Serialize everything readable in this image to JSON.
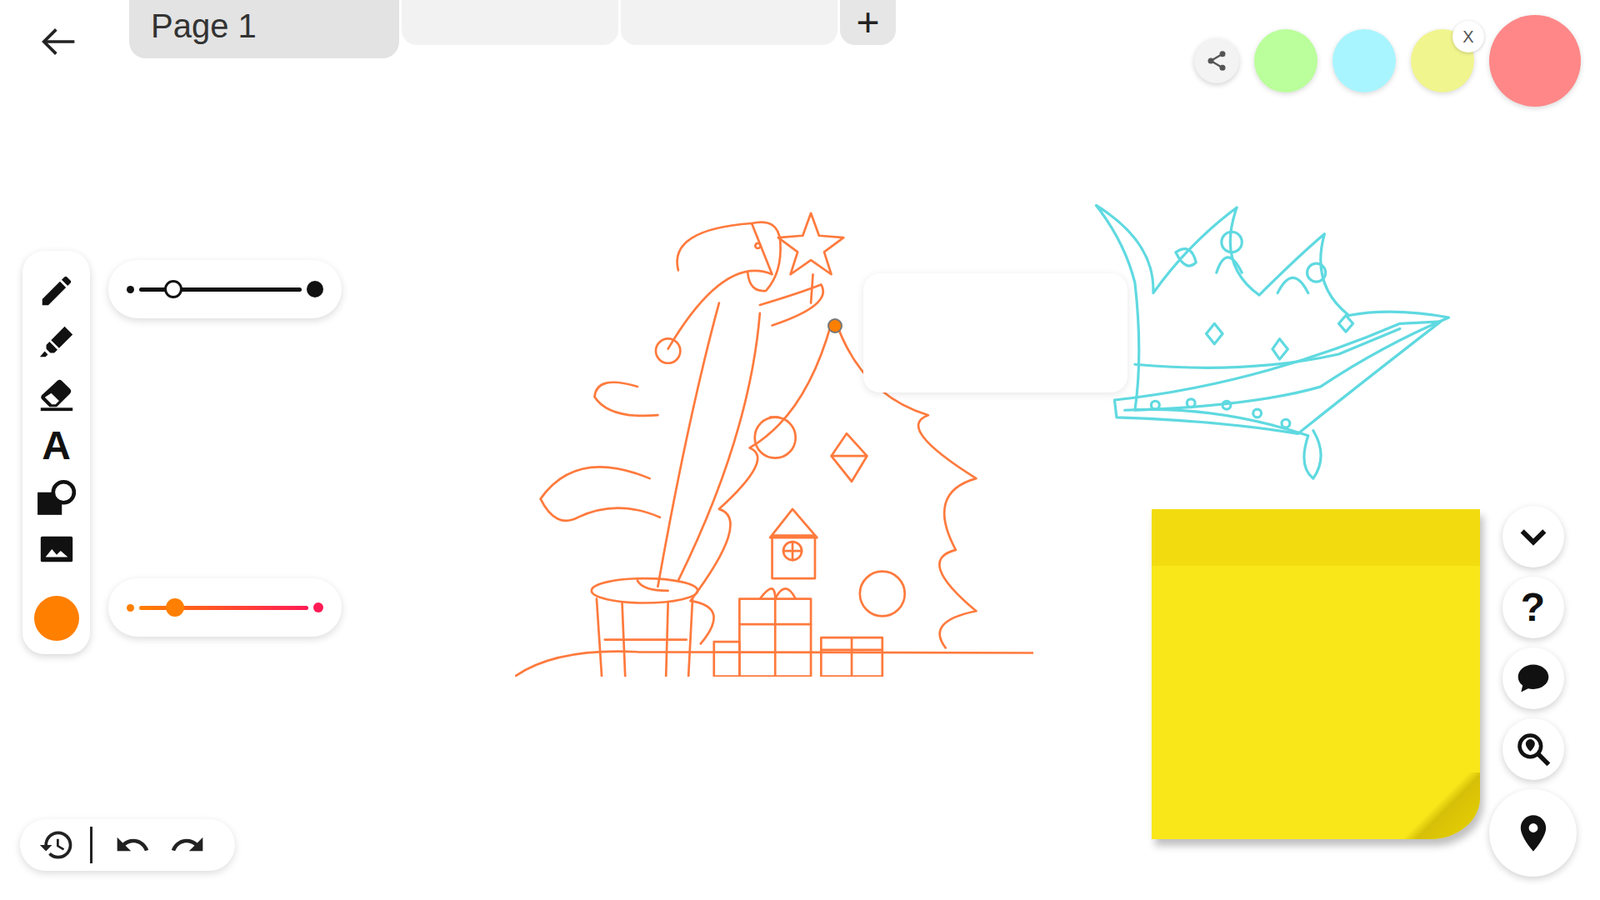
{
  "tabs": [
    {
      "label": "Page 1",
      "selected": true
    },
    {
      "label": "",
      "selected": false
    },
    {
      "label": "",
      "selected": false
    }
  ],
  "add_tab": "+",
  "palette": [
    {
      "color": "#baff9b",
      "selected": false
    },
    {
      "color": "#a8f5ff",
      "selected": false
    },
    {
      "color": "#f1f58e",
      "selected": false,
      "close": "X"
    },
    {
      "color": "#ff8787",
      "selected": true
    }
  ],
  "tools": [
    {
      "kind": "pencil"
    },
    {
      "kind": "highlighter"
    },
    {
      "kind": "eraser"
    },
    {
      "kind": "text",
      "label": "A"
    },
    {
      "kind": "shape"
    },
    {
      "kind": "image"
    }
  ],
  "current_color": "#ff7f00",
  "size_slider": {
    "level": 0.21
  },
  "color_slider": {
    "level": 0.21
  },
  "right_buttons": [
    {
      "kind": "collapse"
    },
    {
      "kind": "help",
      "label": "?"
    },
    {
      "kind": "comment"
    },
    {
      "kind": "zoom"
    },
    {
      "kind": "location"
    }
  ],
  "canvas": {
    "drawings": [
      {
        "kind": "tree",
        "color": "#ff7a3d"
      },
      {
        "kind": "crown",
        "color": "#5fd9e0"
      }
    ],
    "text_box": {
      "text": ""
    },
    "sticky_note": {
      "color": "#f9e71a"
    }
  }
}
